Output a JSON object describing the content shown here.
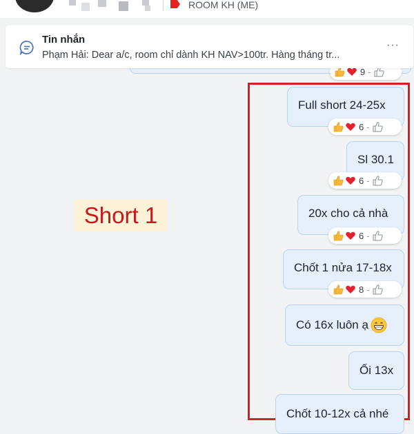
{
  "header": {
    "room_name": "ROOM KH (ME)"
  },
  "pinned": {
    "title": "Tin nhắn",
    "text": "Phạm Hải: Dear a/c, room chỉ dành KH NAV>100tr. Hàng tháng tr...",
    "more": "···"
  },
  "partial_reaction": {
    "count": "9",
    "sep": "-"
  },
  "annotation": {
    "label": "Short 1"
  },
  "messages": [
    {
      "text": "Full short 24-25x",
      "reaction_count": "6",
      "sep": "-"
    },
    {
      "text": "Sl 30.1",
      "reaction_count": "6",
      "sep": "-"
    },
    {
      "text": "20x cho cả nhà",
      "reaction_count": "6",
      "sep": "-"
    },
    {
      "text": "Chốt 1 nửa 17-18x",
      "reaction_count": "8",
      "sep": "-"
    },
    {
      "text": "Có 16x luôn ạ"
    },
    {
      "text": "Ối 13x"
    },
    {
      "text": "Chốt 10-12x cả nhé"
    }
  ],
  "colors": {
    "bubble_bg": "#e5f0fc",
    "bubble_border": "#b8d4f2",
    "highlight_frame": "#d41f24",
    "annotation_text": "#c6191c",
    "annotation_bg": "#fdf3d9",
    "room_icon": "#e0251f"
  }
}
